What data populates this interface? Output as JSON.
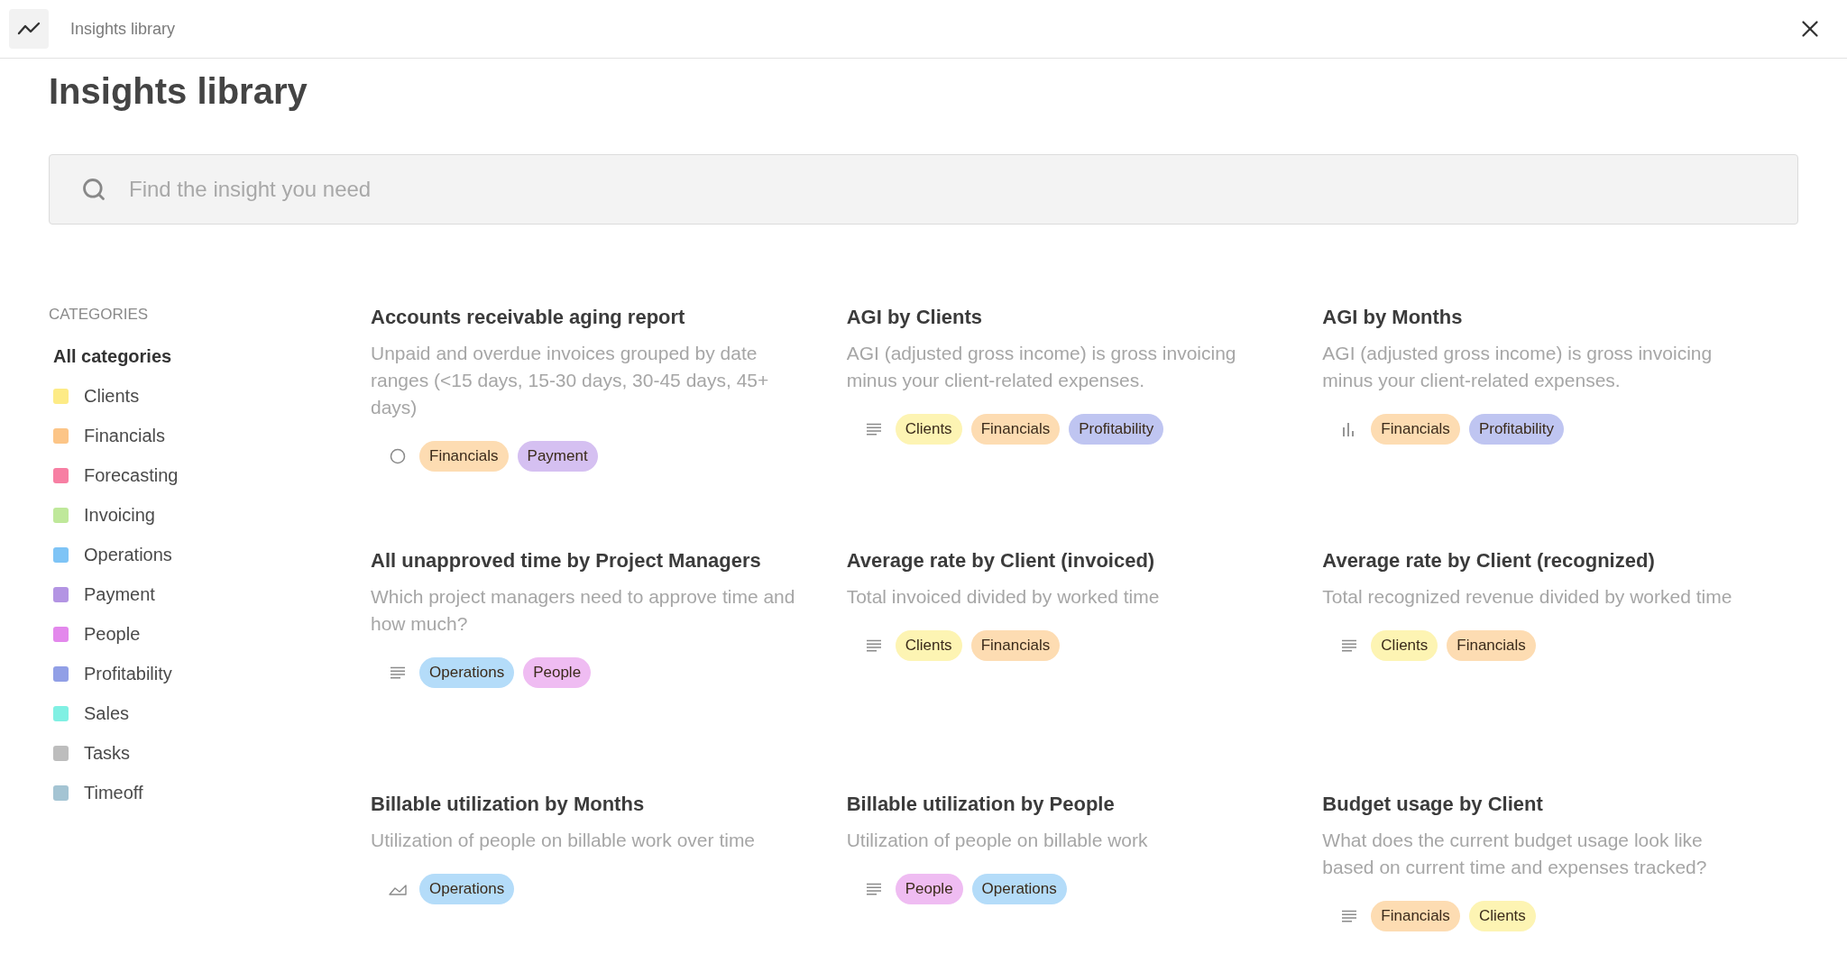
{
  "topbar": {
    "title": "Insights library"
  },
  "page": {
    "heading": "Insights library"
  },
  "search": {
    "placeholder": "Find the insight you need"
  },
  "sidebar": {
    "heading": "CATEGORIES",
    "items": [
      {
        "label": "All categories",
        "selected": true
      },
      {
        "label": "Clients",
        "selected": false,
        "color": "#fdeb86"
      },
      {
        "label": "Financials",
        "selected": false,
        "color": "#fcc587"
      },
      {
        "label": "Forecasting",
        "selected": false,
        "color": "#f77fa3"
      },
      {
        "label": "Invoicing",
        "selected": false,
        "color": "#bfe89a"
      },
      {
        "label": "Operations",
        "selected": false,
        "color": "#7ec4f6"
      },
      {
        "label": "Payment",
        "selected": false,
        "color": "#b394e3"
      },
      {
        "label": "People",
        "selected": false,
        "color": "#e388ec"
      },
      {
        "label": "Profitability",
        "selected": false,
        "color": "#919fe6"
      },
      {
        "label": "Sales",
        "selected": false,
        "color": "#80f0e3"
      },
      {
        "label": "Tasks",
        "selected": false,
        "color": "#bdbdbd"
      },
      {
        "label": "Timeoff",
        "selected": false,
        "color": "#a4c4d3"
      }
    ]
  },
  "insights": [
    {
      "title": "Accounts receivable aging report",
      "description": "Unpaid and overdue invoices grouped by date ranges (<15 days, 15-30 days, 30-45 days, 45+ days)",
      "kind": "pie",
      "tags": [
        {
          "label": "Financials",
          "color": "#fddcb2"
        },
        {
          "label": "Payment",
          "color": "#d5c0f1"
        }
      ]
    },
    {
      "title": "AGI by Clients",
      "description": "AGI (adjusted gross income) is gross invoicing minus your client-related expenses.",
      "kind": "table",
      "tags": [
        {
          "label": "Clients",
          "color": "#fdf4b3"
        },
        {
          "label": "Financials",
          "color": "#fddcb2"
        },
        {
          "label": "Profitability",
          "color": "#bfc5f1"
        }
      ]
    },
    {
      "title": "AGI by Months",
      "description": "AGI (adjusted gross income) is gross invoicing minus your client-related expenses.",
      "kind": "bar",
      "tags": [
        {
          "label": "Financials",
          "color": "#fddcb2"
        },
        {
          "label": "Profitability",
          "color": "#bfc5f1"
        }
      ]
    },
    {
      "title": "All unapproved time by Project Managers",
      "description": "Which project managers need to approve time and how much?",
      "kind": "table",
      "tags": [
        {
          "label": "Operations",
          "color": "#b4dcf9"
        },
        {
          "label": "People",
          "color": "#efbcf2"
        }
      ]
    },
    {
      "title": "Average rate by Client (invoiced)",
      "description": "Total invoiced divided by worked time",
      "kind": "table",
      "tags": [
        {
          "label": "Clients",
          "color": "#fdf4b3"
        },
        {
          "label": "Financials",
          "color": "#fddcb2"
        }
      ]
    },
    {
      "title": "Average rate by Client (recognized)",
      "description": "Total recognized revenue divided by worked time",
      "kind": "table",
      "tags": [
        {
          "label": "Clients",
          "color": "#fdf4b3"
        },
        {
          "label": "Financials",
          "color": "#fddcb2"
        }
      ]
    },
    {
      "title": "Billable utilization by Months",
      "description": "Utilization of people on billable work over time",
      "kind": "area",
      "tags": [
        {
          "label": "Operations",
          "color": "#b4dcf9"
        }
      ]
    },
    {
      "title": "Billable utilization by People",
      "description": "Utilization of people on billable work",
      "kind": "table",
      "tags": [
        {
          "label": "People",
          "color": "#efbcf2"
        },
        {
          "label": "Operations",
          "color": "#b4dcf9"
        }
      ]
    },
    {
      "title": "Budget usage by Client",
      "description": "What does the current budget usage look like based on current time and expenses tracked?",
      "kind": "table",
      "tags": [
        {
          "label": "Financials",
          "color": "#fddcb2"
        },
        {
          "label": "Clients",
          "color": "#fdf4b3"
        }
      ]
    }
  ]
}
